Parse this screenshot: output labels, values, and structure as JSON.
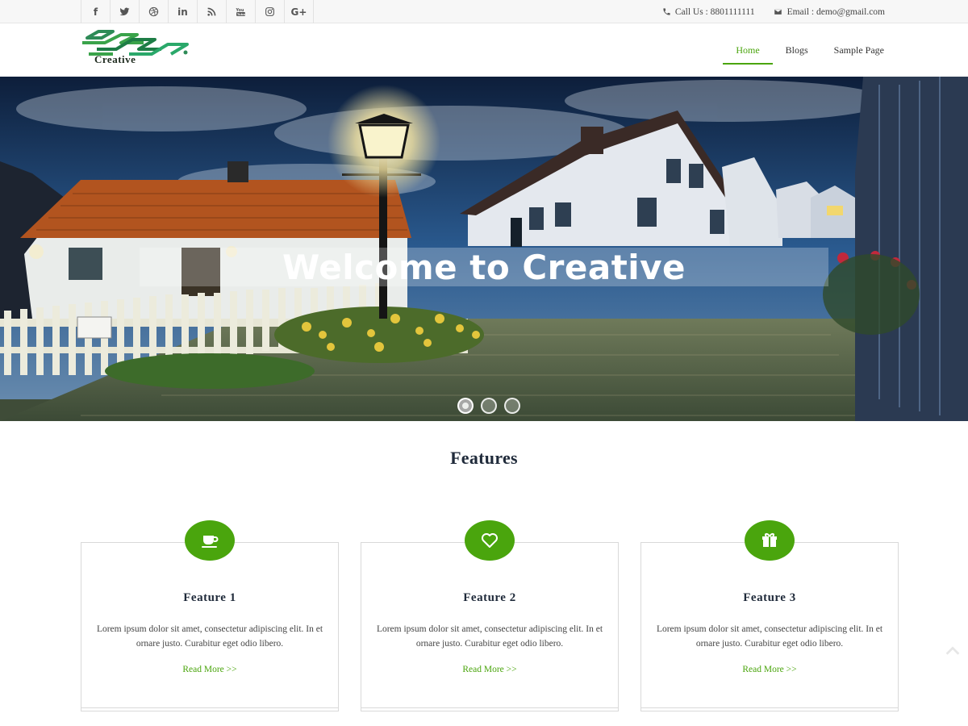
{
  "topbar": {
    "social": [
      {
        "name": "facebook-icon",
        "glyph": "f"
      },
      {
        "name": "twitter-icon",
        "glyph": ""
      },
      {
        "name": "dribbble-icon",
        "glyph": ""
      },
      {
        "name": "linkedin-icon",
        "glyph": "in"
      },
      {
        "name": "rss-icon",
        "glyph": ""
      },
      {
        "name": "youtube-icon",
        "glyph": "You"
      },
      {
        "name": "instagram-icon",
        "glyph": ""
      },
      {
        "name": "google-plus-icon",
        "glyph": "G+"
      }
    ],
    "phone": "Call Us : 8801111111",
    "email": "Email : demo@gmail.com"
  },
  "header": {
    "logo_text": "Creative",
    "nav": [
      {
        "label": "Home",
        "active": true
      },
      {
        "label": "Blogs",
        "active": false
      },
      {
        "label": "Sample Page",
        "active": false
      }
    ]
  },
  "hero": {
    "title": "Welcome to Creative",
    "slides": 3,
    "active_slide": 1
  },
  "features": {
    "title": "Features",
    "items": [
      {
        "icon": "coffee-cup-icon",
        "title": "Feature 1",
        "text": "Lorem ipsum dolor sit amet, consectetur adipiscing elit. In et ornare justo. Curabitur eget odio libero.",
        "link": "Read More >>"
      },
      {
        "icon": "heart-icon",
        "title": "Feature 2",
        "text": "Lorem ipsum dolor sit amet, consectetur adipiscing elit. In et ornare justo. Curabitur eget odio libero.",
        "link": "Read More >>"
      },
      {
        "icon": "gift-icon",
        "title": "Feature 3",
        "text": "Lorem ipsum dolor sit amet, consectetur adipiscing elit. In et ornare justo. Curabitur eget odio libero.",
        "link": "Read More >>"
      }
    ]
  },
  "colors": {
    "accent": "#4aa50d",
    "heading": "#1f2a3a",
    "topbar_bg": "#f7f7f7"
  }
}
